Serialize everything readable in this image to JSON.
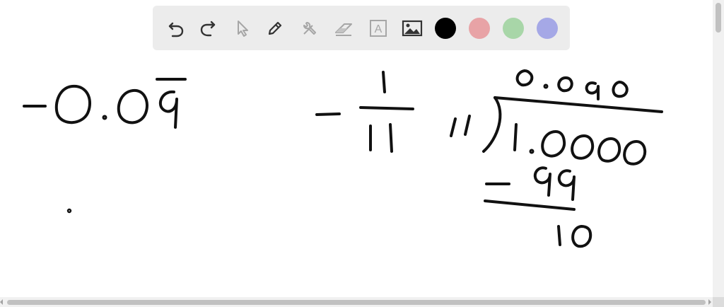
{
  "toolbar": {
    "tools": [
      {
        "name": "undo-icon",
        "state": "enabled"
      },
      {
        "name": "redo-icon",
        "state": "enabled"
      },
      {
        "name": "select-pointer-icon",
        "state": "disabled"
      },
      {
        "name": "pen-icon",
        "state": "enabled"
      },
      {
        "name": "tools-icon",
        "state": "disabled"
      },
      {
        "name": "eraser-icon",
        "state": "disabled"
      },
      {
        "name": "text-icon",
        "state": "disabled",
        "glyph": "A"
      },
      {
        "name": "image-icon",
        "state": "enabled"
      }
    ],
    "colors": [
      "#000000",
      "#e8a3a6",
      "#a8d6a8",
      "#a5a8e6"
    ],
    "selected_color": "#000000",
    "icon_color": "#333333",
    "disabled_icon_color": "#a6a6a6"
  }
}
